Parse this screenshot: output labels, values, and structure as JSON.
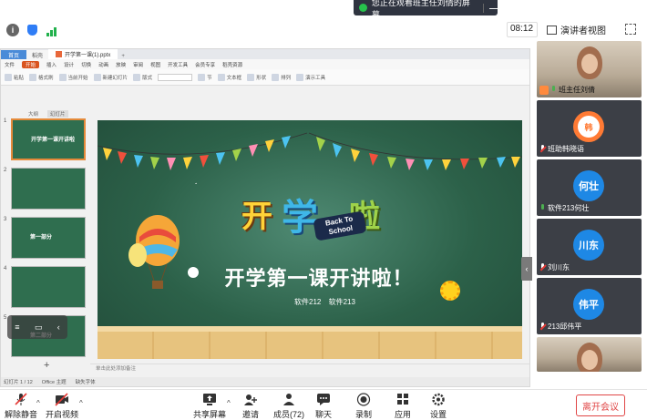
{
  "share_banner": {
    "text": "您正在观看班主任刘倩的屏幕",
    "minimize_label": "—"
  },
  "meeting_top": {
    "time": "08:12",
    "presenter_view_label": "演讲者视图"
  },
  "wps": {
    "tabs": {
      "home": "首页",
      "doc": "稻壳",
      "file": "开学第一课(1).pptx",
      "plus": "+"
    },
    "menu": [
      "文件",
      "开始",
      "插入",
      "设计",
      "切换",
      "动画",
      "放映",
      "审阅",
      "视图",
      "开发工具",
      "会员专享",
      "稻壳资源"
    ],
    "active_menu": "开始",
    "ribbon": [
      "粘贴",
      "格式刷",
      "当前开始",
      "新建幻灯片",
      "版式",
      "节",
      "文本框",
      "形状",
      "排列",
      "演示工具"
    ],
    "thumb_tabs": [
      "大纲",
      "幻灯片"
    ],
    "active_thumb_tab": "幻灯片",
    "thumbs": [
      {
        "num": "1",
        "text": "开学第一课开讲啦"
      },
      {
        "num": "2",
        "text": ""
      },
      {
        "num": "3",
        "text": "第一部分"
      },
      {
        "num": "4",
        "text": ""
      },
      {
        "num": "5",
        "text": "第二部分"
      }
    ],
    "thumb_add": "+",
    "slide": {
      "logo": {
        "kai": "开",
        "xue": "学",
        "la": "啦"
      },
      "back_to_school": [
        "Back To",
        "School"
      ],
      "title": "开学第一课开讲啦！",
      "subtitle": "软件212  软件213"
    },
    "notes_placeholder": "单击此处添加备注",
    "status": {
      "slide": "幻灯片 1 / 12",
      "theme": "Office 主题",
      "missing_font": "缺失字体"
    },
    "collapse_icon": "‹"
  },
  "mini_controls": {
    "icons": [
      "≡",
      "▭",
      "‹"
    ]
  },
  "participants": [
    {
      "name": "班主任刘倩",
      "type": "video",
      "mic": "on",
      "host": true
    },
    {
      "name": "班助韩晓语",
      "type": "avatar",
      "avatar_text": "韩",
      "style": "orange",
      "mic": "off"
    },
    {
      "name": "软件213何壮",
      "type": "avatar",
      "avatar_text": "何壮",
      "mic": "on"
    },
    {
      "name": "刘川东",
      "type": "avatar",
      "avatar_text": "川东",
      "mic": "off"
    },
    {
      "name": "213邱伟平",
      "type": "avatar",
      "avatar_text": "伟平",
      "mic": "off"
    },
    {
      "name": "",
      "type": "video-partial"
    }
  ],
  "bottom_bar": {
    "mute": "解除静音",
    "video": "开启视频",
    "share": "共享屏幕",
    "invite": "邀请",
    "members": "成员(72)",
    "chat": "聊天",
    "record": "录制",
    "apps": "应用",
    "settings": "设置",
    "leave": "离开会议"
  },
  "colors": {
    "accent": "#2f7df6",
    "wps_orange": "#d9541f",
    "leave_red": "#e04646",
    "slide_green": "#2c6149"
  }
}
